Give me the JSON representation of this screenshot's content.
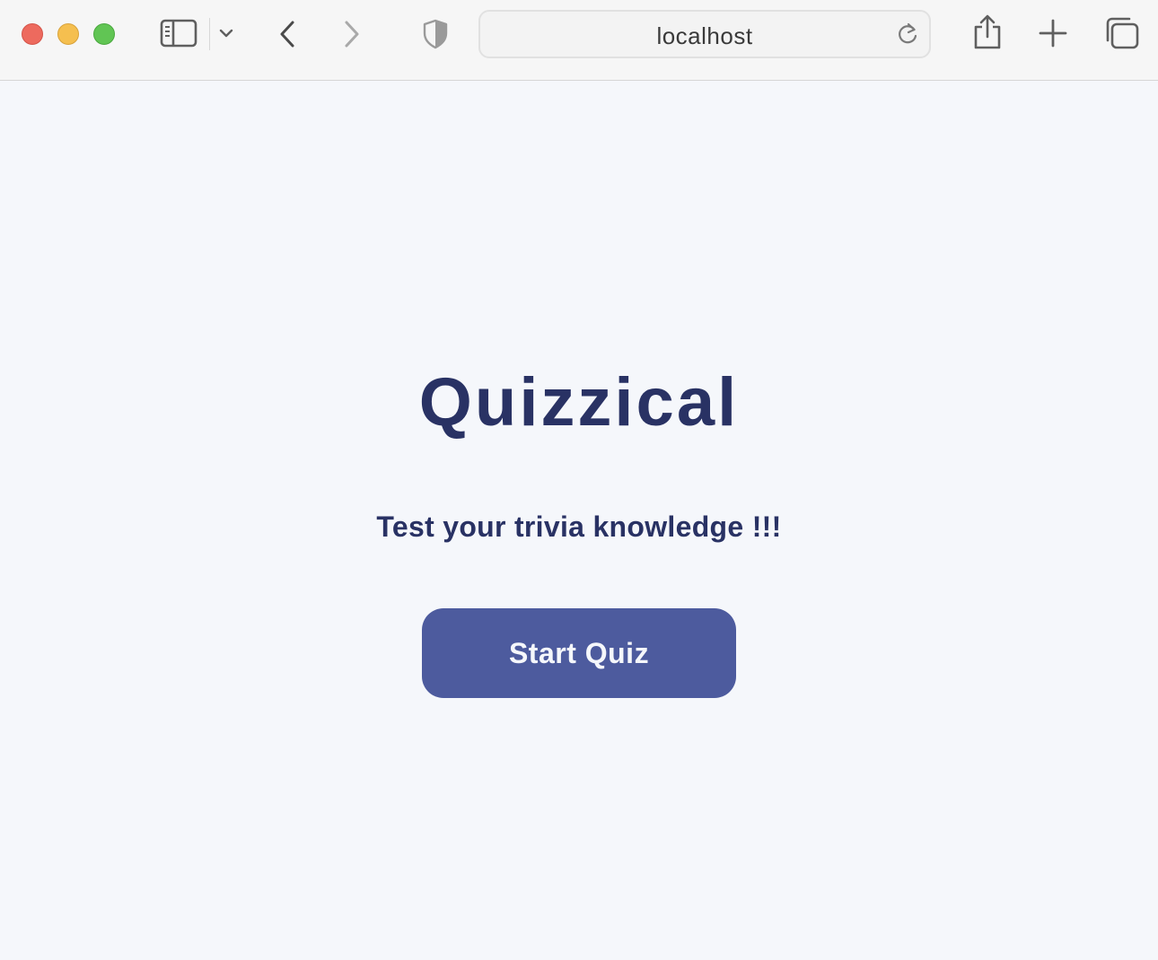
{
  "window": {
    "controls": [
      "close",
      "minimize",
      "maximize"
    ]
  },
  "toolbar": {
    "icons": {
      "sidebar": "sidebar-icon",
      "sidebar_menu": "chevron-down-icon",
      "back": "chevron-left-icon",
      "forward": "chevron-right-icon",
      "privacy": "shield-icon",
      "reload": "reload-icon",
      "share": "share-icon",
      "new_tab": "plus-icon",
      "tab_overview": "tabs-icon"
    },
    "address": "localhost"
  },
  "page": {
    "title": "Quizzical",
    "subtitle": "Test your trivia knowledge !!!",
    "start_button_label": "Start Quiz"
  },
  "colors": {
    "background": "#f5f7fb",
    "text": "#293264",
    "button": "#4d5b9e",
    "button_text": "#f5f7fb"
  }
}
